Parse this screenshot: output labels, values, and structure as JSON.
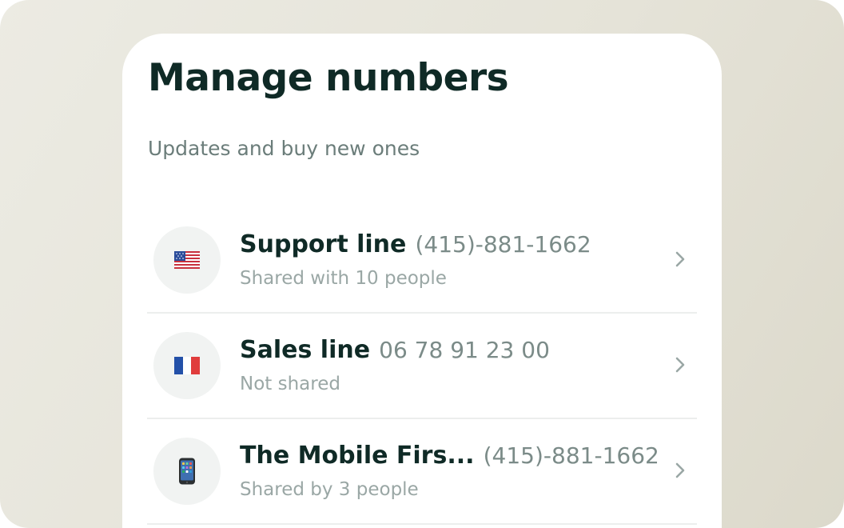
{
  "page": {
    "title": "Manage numbers",
    "subtitle": "Updates and buy new ones"
  },
  "numbers": [
    {
      "name": "Support line",
      "number": "(415)-881-1662",
      "status": "Shared with 10 people",
      "icon": "us-flag-icon"
    },
    {
      "name": "Sales line",
      "number": "06 78 91 23 00",
      "status": "Not shared",
      "icon": "fr-flag-icon"
    },
    {
      "name": "The Mobile Firs...",
      "number": "(415)-881-1662",
      "status": "Shared by 3 people",
      "icon": "mobile-phone-icon"
    }
  ],
  "colors": {
    "title": "#0f2a26",
    "muted": "#7b8b88",
    "background": "#e5e3d8",
    "card": "#ffffff"
  }
}
